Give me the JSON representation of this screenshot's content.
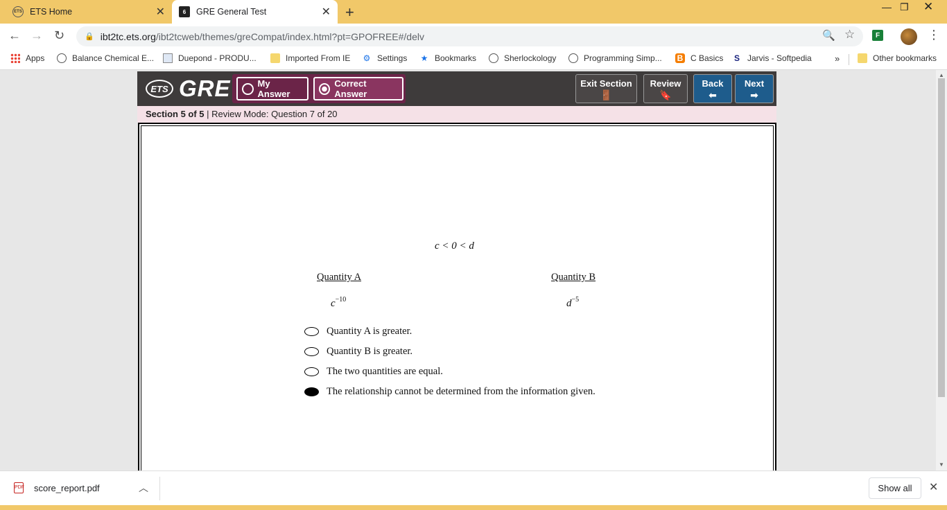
{
  "tabs": [
    {
      "title": "ETS Home",
      "favicon": "ets-logo-icon",
      "active": false
    },
    {
      "title": "GRE General Test",
      "favicon": "ets-app-icon",
      "active": true
    }
  ],
  "address_bar": {
    "host": "ibt2tc.ets.org",
    "path": "/ibt2tcweb/themes/greCompat/index.html?pt=GPOFREE#/delv"
  },
  "bookmarks": [
    {
      "label": "Apps",
      "icon": "apps-grid-icon"
    },
    {
      "label": "Balance Chemical E...",
      "icon": "globe-icon"
    },
    {
      "label": "Duepond - PRODU...",
      "icon": "document-icon"
    },
    {
      "label": "Imported From IE",
      "icon": "folder-icon"
    },
    {
      "label": "Settings",
      "icon": "gear-icon"
    },
    {
      "label": "Bookmarks",
      "icon": "star-icon"
    },
    {
      "label": "Sherlockology",
      "icon": "globe-icon"
    },
    {
      "label": "Programming Simp...",
      "icon": "globe-icon"
    },
    {
      "label": "C Basics",
      "icon": "blogger-icon"
    },
    {
      "label": "Jarvis - Softpedia",
      "icon": "softpedia-icon"
    }
  ],
  "bookmarks_overflow": "»",
  "other_bookmarks": "Other bookmarks",
  "ets": {
    "logo_small": "ETS",
    "logo_product": "GRE",
    "my_answer": "My Answer",
    "correct_answer": "Correct Answer",
    "exit_section": "Exit Section",
    "review": "Review",
    "back": "Back",
    "next": "Next"
  },
  "status": {
    "section": "Section 5 of 5",
    "mode": "| Review Mode: Question 7 of 20"
  },
  "question": {
    "condition": "c < 0 < d",
    "quantity_a_label": "Quantity A",
    "quantity_b_label": "Quantity B",
    "quantity_a_base": "c",
    "quantity_a_exp": "−10",
    "quantity_b_base": "d",
    "quantity_b_exp": "−5",
    "choices": [
      {
        "text": "Quantity A is greater.",
        "selected": false
      },
      {
        "text": "Quantity B is greater.",
        "selected": false
      },
      {
        "text": "The two quantities are equal.",
        "selected": false
      },
      {
        "text": "The relationship cannot be determined from the information given.",
        "selected": true
      }
    ]
  },
  "downloads": {
    "file": "score_report.pdf",
    "show_all": "Show all"
  },
  "colors": {
    "chrome_frame": "#f1c869",
    "ets_header": "#3e3b3b",
    "answer_group": "#6b2448",
    "nav_blue": "#1e5c8c",
    "status_bar": "#f5e1e7"
  }
}
